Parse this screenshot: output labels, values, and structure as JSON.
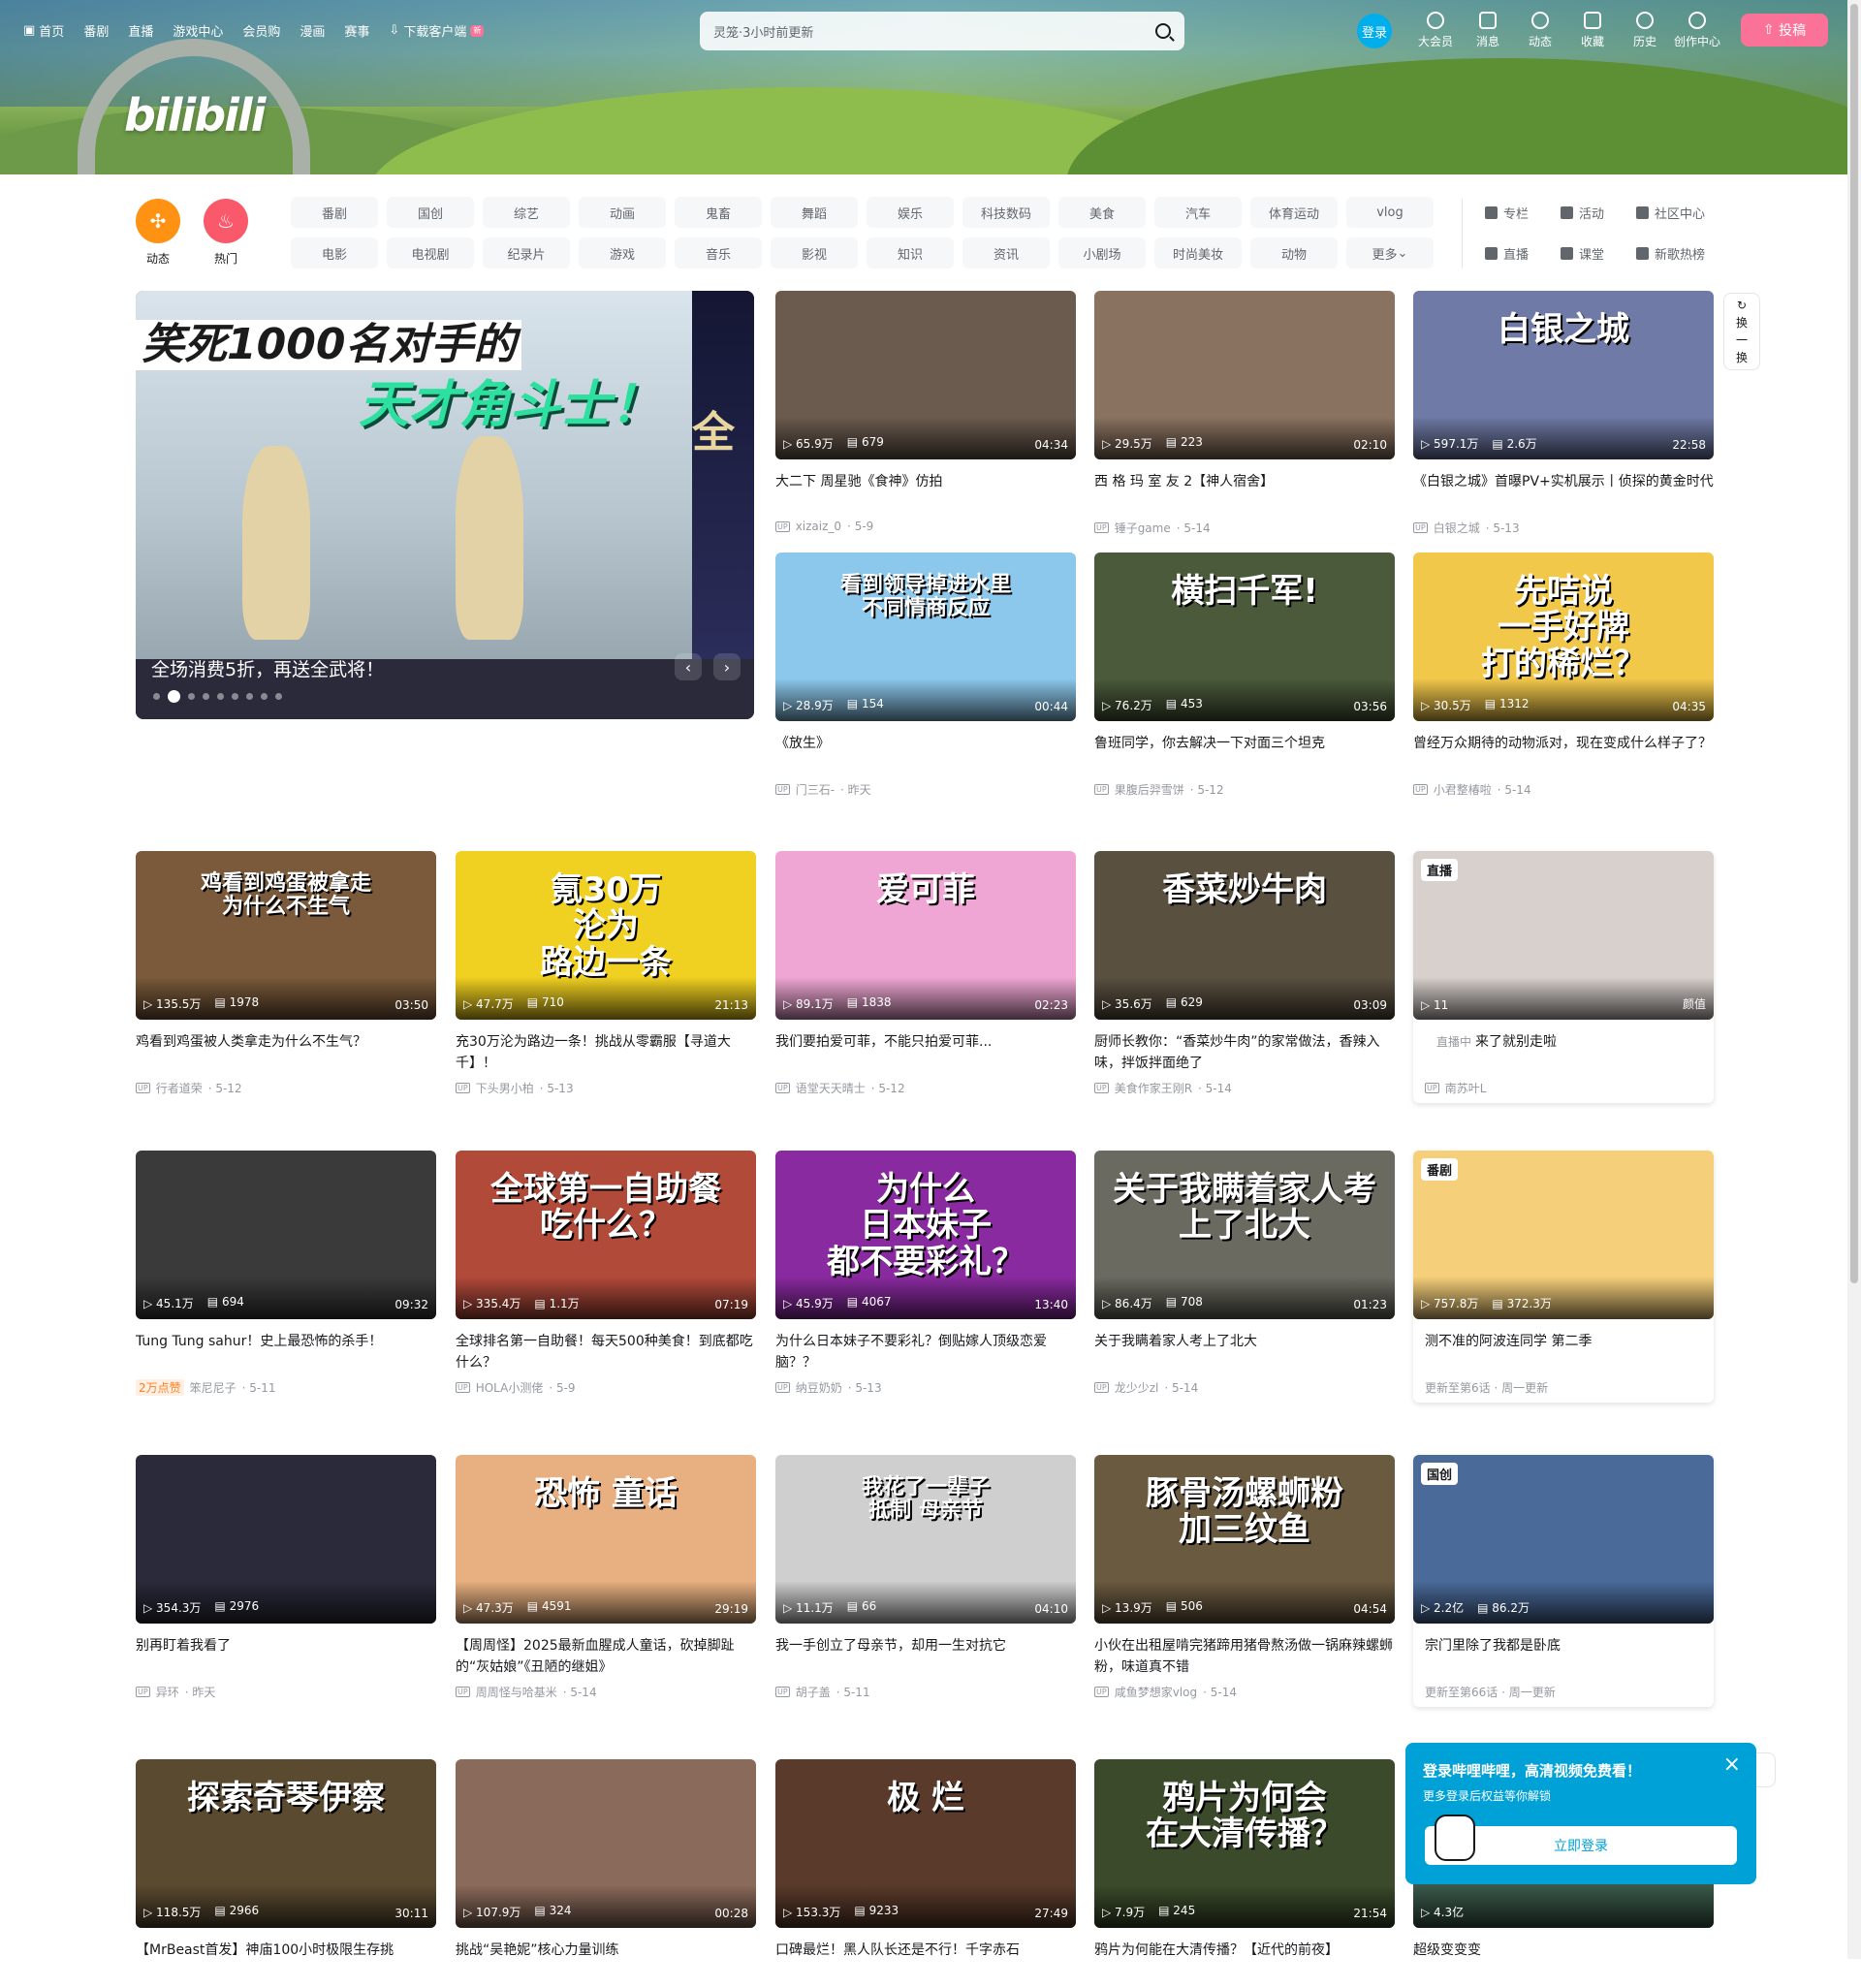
{
  "topnav": [
    "首页",
    "番剧",
    "直播",
    "游戏中心",
    "会员购",
    "漫画",
    "赛事",
    "下载客户端"
  ],
  "topnav_new": "新",
  "search": {
    "placeholder": "灵笼·3小时前更新"
  },
  "rightnav": {
    "login": "登录",
    "items": [
      "大会员",
      "消息",
      "动态",
      "收藏",
      "历史",
      "创作中心"
    ],
    "upload": "投稿"
  },
  "logo": "bilibili",
  "quick": [
    {
      "label": "动态",
      "color": "#ff9212"
    },
    {
      "label": "热门",
      "color": "#f9596a"
    }
  ],
  "tags_row1": [
    "番剧",
    "国创",
    "综艺",
    "动画",
    "鬼畜",
    "舞蹈",
    "娱乐",
    "科技数码",
    "美食",
    "汽车",
    "体育运动",
    "vlog"
  ],
  "tags_row2": [
    "电影",
    "电视剧",
    "纪录片",
    "游戏",
    "音乐",
    "影视",
    "知识",
    "资讯",
    "小剧场",
    "时尚美妆",
    "动物",
    "更多"
  ],
  "ext": [
    "专栏",
    "活动",
    "社区中心",
    "直播",
    "课堂",
    "新歌热榜"
  ],
  "carousel": {
    "t1": "笑死1000名对手的",
    "t2": "天才角斗士！",
    "side": "全",
    "title": "全场消费5折，再送全武将！",
    "dots": 9,
    "active": 1
  },
  "refresh": [
    "换",
    "一",
    "换"
  ],
  "cards": [
    {
      "views": "65.9万",
      "dm": "679",
      "dur": "04:34",
      "title": "大二下 周星驰《食神》仿拍",
      "up": "xizaiz_0",
      "date": "5-9",
      "bg": "#6b5b4e"
    },
    {
      "views": "29.5万",
      "dm": "223",
      "dur": "02:10",
      "title": "西 格 玛 室 友 2【神人宿舍】",
      "up": "锤子game",
      "date": "5-14",
      "bg": "#8a7260"
    },
    {
      "views": "597.1万",
      "dm": "2.6万",
      "dur": "22:58",
      "title": "《白银之城》首曝PV+实机展示丨侦探的黄金时代",
      "up": "白银之城",
      "date": "5-13",
      "bg": "#6f7aa6",
      "ov": "白银之城"
    },
    {
      "views": "28.9万",
      "dm": "154",
      "dur": "00:44",
      "title": "《放生》",
      "up": "门三石-",
      "date": "昨天",
      "bg": "#8cc8ec",
      "ov": "看到领导掉进水里\n不同情商反应"
    },
    {
      "views": "76.2万",
      "dm": "453",
      "dur": "03:56",
      "title": "鲁班同学，你去解决一下对面三个坦克",
      "up": "果腹后羿雪饼",
      "date": "5-12",
      "bg": "#4a5a3a",
      "ov": "横扫千军!"
    },
    {
      "views": "30.5万",
      "dm": "1312",
      "dur": "04:35",
      "title": "曾经万众期待的动物派对，现在变成什么样子了？",
      "up": "小君整椿啦",
      "date": "5-14",
      "bg": "#f2c84a",
      "ov": "先咭说\n一手好牌\n打的稀烂？"
    },
    {
      "views": "135.5万",
      "dm": "1978",
      "dur": "03:50",
      "title": "鸡看到鸡蛋被人类拿走为什么不生气？",
      "up": "行者道荣",
      "date": "5-12",
      "bg": "#7a5a3a",
      "ov": "鸡看到鸡蛋被拿走\n为什么不生气"
    },
    {
      "views": "47.7万",
      "dm": "710",
      "dur": "21:13",
      "title": "充30万沦为路边一条！挑战从零霸服【寻道大千】！",
      "up": "下头男小柏",
      "date": "5-13",
      "bg": "#f0d020",
      "ov": "氪30万\n沦为\n路边一条"
    },
    {
      "views": "89.1万",
      "dm": "1838",
      "dur": "02:23",
      "title": "我们要拍爱可菲，不能只拍爱可菲...",
      "up": "语堂天天晴士",
      "date": "5-12",
      "bg": "#f0a6d4",
      "ov": "爱可菲"
    },
    {
      "views": "35.6万",
      "dm": "629",
      "dur": "03:09",
      "title": "厨师长教你：“香菜炒牛肉”的家常做法，香辣入味，拌饭拌面绝了",
      "up": "美食作家王刚R",
      "date": "5-14",
      "bg": "#5a5040",
      "ov": "香菜炒牛肉"
    },
    {
      "views": "11",
      "dm": "",
      "dur": "颜值",
      "title": "来了就别走啦",
      "up": "南苏叶L",
      "date": "",
      "bg": "#d8d0cc",
      "badge": "直播",
      "live": "直播中"
    },
    {
      "views": "45.1万",
      "dm": "694",
      "dur": "09:32",
      "title": "Tung Tung sahur！史上最恐怖的杀手！",
      "up": "笨尼尼子",
      "date": "5-11",
      "bg": "#3a3a3a",
      "hot": "2万点赞"
    },
    {
      "views": "335.4万",
      "dm": "1.1万",
      "dur": "07:19",
      "title": "全球排名第一自助餐！每天500种美食！到底都吃什么？",
      "up": "HOLA小测佬",
      "date": "5-9",
      "bg": "#b24a3a",
      "ov": "全球第一自助餐\n吃什么？"
    },
    {
      "views": "45.9万",
      "dm": "4067",
      "dur": "13:40",
      "title": "为什么日本妹子不要彩礼？倒贴嫁人顶级恋爱脑？？",
      "up": "纳豆奶奶",
      "date": "5-13",
      "bg": "#8a2aa0",
      "ov": "为什么\n日本妹子\n都不要彩礼？"
    },
    {
      "views": "86.4万",
      "dm": "708",
      "dur": "01:23",
      "title": "关于我瞒着家人考上了北大",
      "up": "龙少少zl",
      "date": "5-14",
      "bg": "#6a6a60",
      "ov": "关于我瞒着家人考上了北大"
    },
    {
      "views": "757.8万",
      "dm": "372.3万",
      "dur": "",
      "title": "测不准的阿波连同学 第二季",
      "up": "",
      "date": "更新至第6话 · 周一更新",
      "bg": "#f6cf7a",
      "badge": "番剧"
    },
    {
      "views": "354.3万",
      "dm": "2976",
      "dur": "",
      "title": "别再盯着我看了",
      "up": "异环",
      "date": "昨天",
      "bg": "#2a2a3a"
    },
    {
      "views": "47.3万",
      "dm": "4591",
      "dur": "29:19",
      "title": "【周周怪】2025最新血腥成人童话，砍掉脚趾的“灰姑娘”《丑陋的继姐》",
      "up": "周周怪与哈基米",
      "date": "5-14",
      "bg": "#e8b080",
      "ov": "恐怖 童话"
    },
    {
      "views": "11.1万",
      "dm": "66",
      "dur": "04:10",
      "title": "我一手创立了母亲节，却用一生对抗它",
      "up": "胡子盖",
      "date": "5-11",
      "bg": "#cfcfcf",
      "ov": "我花了一辈子\n抵制 母亲节"
    },
    {
      "views": "13.9万",
      "dm": "506",
      "dur": "04:54",
      "title": "小伙在出租屋啃完猪蹄用猪骨熬汤做一锅麻辣螺蛳粉，味道真不错",
      "up": "咸鱼梦想家vlog",
      "date": "5-14",
      "bg": "#6a5a40",
      "ov": "豚骨汤螺蛳粉\n加三纹鱼"
    },
    {
      "views": "2.2亿",
      "dm": "86.2万",
      "dur": "",
      "title": "宗门里除了我都是卧底",
      "up": "",
      "date": "更新至第66话 · 周一更新",
      "bg": "#4a6a9a",
      "badge": "国创"
    },
    {
      "views": "118.5万",
      "dm": "2966",
      "dur": "30:11",
      "title": "【MrBeast首发】神庙100小时极限生存挑",
      "up": "",
      "date": "",
      "bg": "#5a4a30",
      "ov": "探索奇琴伊察"
    },
    {
      "views": "107.9万",
      "dm": "324",
      "dur": "00:28",
      "title": "挑战“吴艳妮”核心力量训练",
      "up": "",
      "date": "",
      "bg": "#8a6a5a"
    },
    {
      "views": "153.3万",
      "dm": "9233",
      "dur": "27:49",
      "title": "口碑最烂！黑人队长还是不行！千字赤石",
      "up": "",
      "date": "",
      "bg": "#5a3a2a",
      "ov": "极  烂"
    },
    {
      "views": "7.9万",
      "dm": "245",
      "dur": "21:54",
      "title": "鸦片为何能在大清传播？【近代的前夜】",
      "up": "",
      "date": "",
      "bg": "#3a4a2a",
      "ov": "鸦片为何会\n在大清传播？"
    },
    {
      "views": "4.3亿",
      "dm": "",
      "dur": "",
      "title": "超级变变变",
      "up": "",
      "date": "",
      "bg": "#3a5a4a"
    }
  ],
  "popup": {
    "title": "登录哔哩哔哩，高清视频免费看！",
    "sub": "更多登录后权益等你解锁",
    "btn": "立即登录"
  }
}
